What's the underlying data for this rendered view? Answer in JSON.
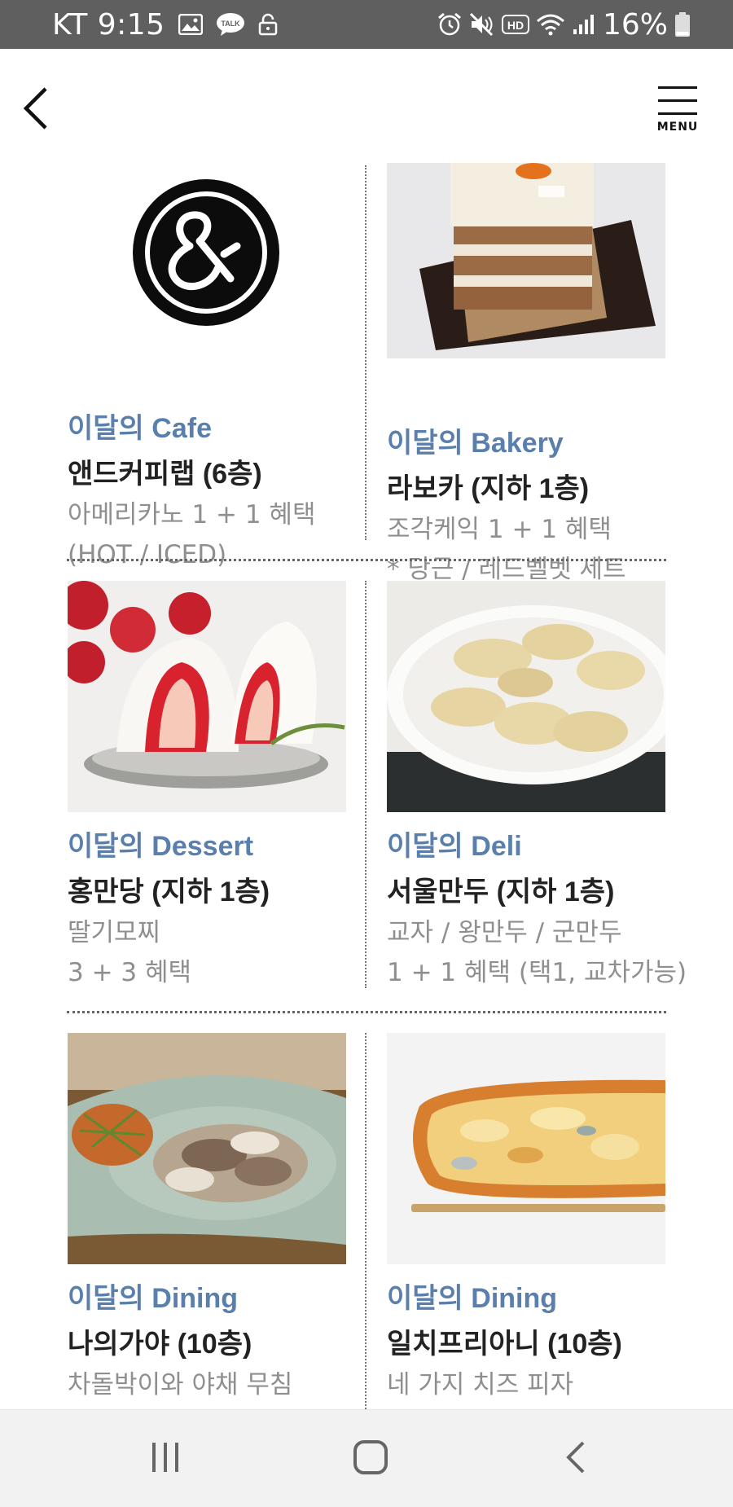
{
  "status_bar": {
    "carrier_time": "KT 9:15",
    "battery_percent": "16%",
    "background_color": "#5f5f5f",
    "left_icons": [
      "image-icon",
      "kakaotalk-icon",
      "chat-bubble-icon",
      "lock-icon"
    ],
    "right_icons": [
      "alarm-icon",
      "mute-icon",
      "hd-icon",
      "wifi-icon",
      "signal-icon",
      "battery-icon"
    ],
    "talk_badge": "TALK",
    "hd_badge": "HD"
  },
  "header": {
    "back_icon": "chevron-left-icon",
    "menu_label": "MENU"
  },
  "accent_color": "#5a7fad",
  "cards": [
    {
      "category": "이달의 Cafe",
      "store": "앤드커피랩 (6층)",
      "desc1": "아메리카노 1 + 1 혜택",
      "desc2": "(HOT / ICED)",
      "image": "and-coffee-lab-logo"
    },
    {
      "category": "이달의 Bakery",
      "store": "라보카 (지하 1층)",
      "desc1": "조각케익 1 + 1 혜택",
      "desc2": "* 당근 / 레드벨벳 세트",
      "image": "carrot-cake-photo"
    },
    {
      "category": "이달의 Dessert",
      "store": "홍만당 (지하 1층)",
      "desc1": "딸기모찌",
      "desc2": "3 + 3 혜택",
      "image": "strawberry-mochi-photo"
    },
    {
      "category": "이달의 Deli",
      "store": "서울만두 (지하 1층)",
      "desc1": "교자 / 왕만두 / 군만두",
      "desc2": "1 + 1 혜택 (택1, 교차가능)",
      "image": "dumplings-photo"
    },
    {
      "category": "이달의 Dining",
      "store": "나의가야 (10층)",
      "desc1": "차돌박이와 야채 무침",
      "desc2": "",
      "image": "beef-brisket-salad-photo"
    },
    {
      "category": "이달의 Dining",
      "store": "일치프리아니 (10층)",
      "desc1": "네 가지 치즈 피자",
      "desc2": "",
      "image": "four-cheese-pizza-photo"
    }
  ],
  "nav_bar": {
    "buttons": [
      "recent-apps-icon",
      "home-icon",
      "back-icon"
    ],
    "background_color": "#f2f2f2"
  }
}
